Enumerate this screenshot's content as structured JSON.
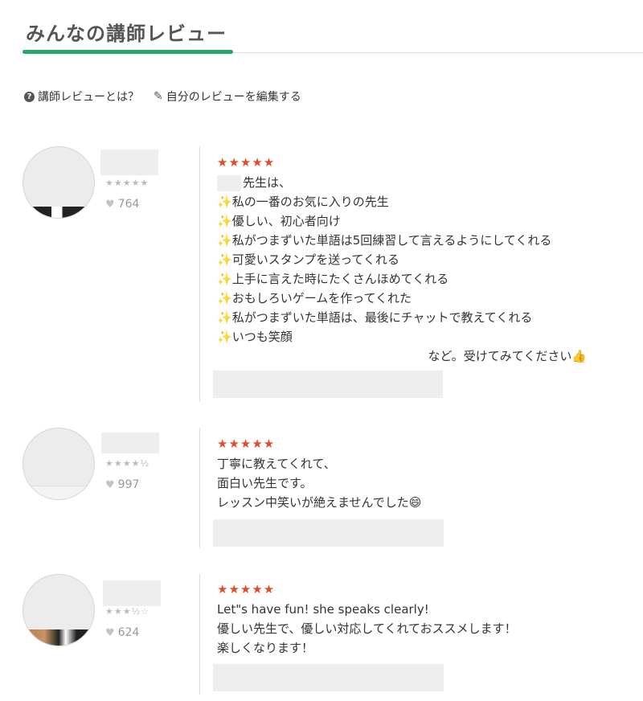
{
  "page": {
    "title": "みんなの講師レビュー",
    "links": {
      "about": "講師レビューとは？",
      "edit": "自分のレビューを編集する"
    }
  },
  "colors": {
    "accent": "#2aa56a",
    "star": "#e04b2c",
    "sparkle": "#f4c430"
  },
  "icons": [
    "question-circle-icon",
    "pencil-icon",
    "heart-icon",
    "sparkles-icon",
    "thumbs-up-icon",
    "grinning-face-icon"
  ],
  "reviews": [
    {
      "mini_stars": "★★★★★",
      "mini_rating": 5,
      "likes": "764",
      "stars": "★★★★★",
      "lines": [
        "先生は、",
        "私の一番のお気に入りの先生",
        "優しい、初心者向け",
        "私がつまずいた単語は5回練習して言えるようにしてくれる",
        "可愛いスタンプを送ってくれる",
        "上手に言えた時にたくさんほめてくれる",
        "おもしろいゲームを作ってくれた",
        "私がつまずいた単語は、最後にチャットで教えてくれる",
        "いつも笑顔",
        "など。受けてみてください👍"
      ]
    },
    {
      "mini_stars": "★★★★½",
      "mini_rating": 4.5,
      "likes": "997",
      "stars": "★★★★★",
      "lines": [
        "丁寧に教えてくれて、",
        "面白い先生です。",
        "レッスン中笑いが絶えませんでした😄"
      ]
    },
    {
      "mini_stars": "★★★½☆",
      "mini_rating": 3.5,
      "likes": "624",
      "stars": "★★★★★",
      "lines": [
        "Let\"s have fun! she speaks clearly!",
        "優しい先生で、優しい対応してくれておススメします！",
        "楽しくなります！"
      ]
    }
  ]
}
